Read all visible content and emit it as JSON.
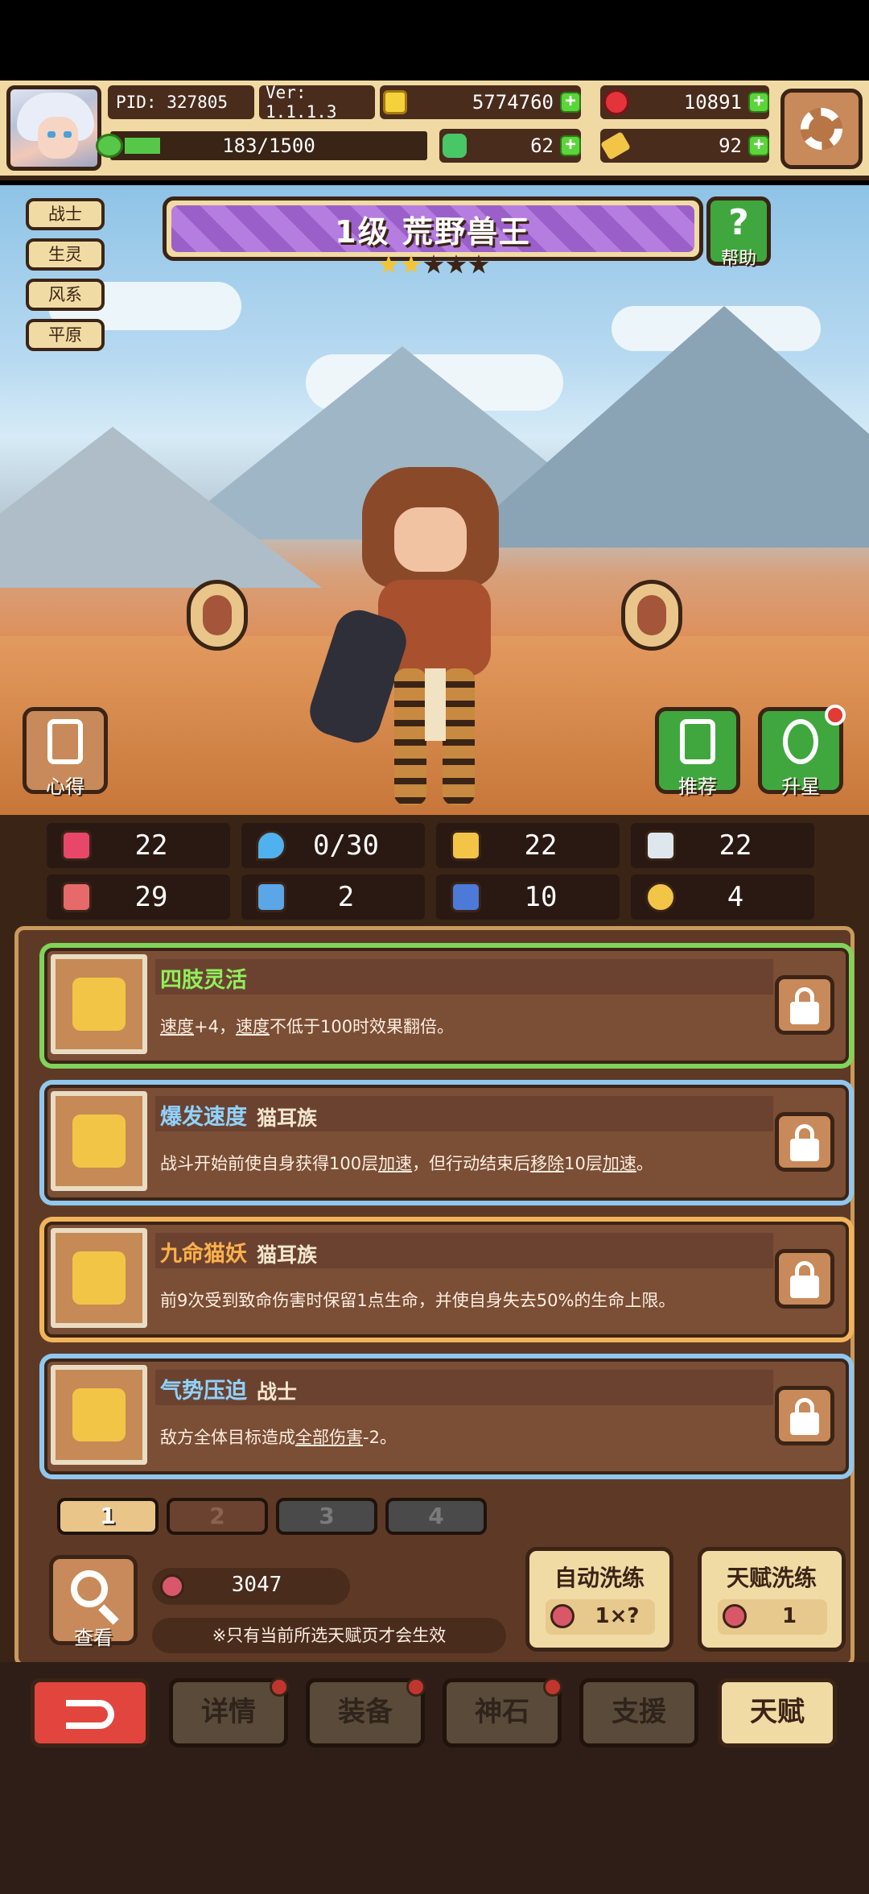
{
  "header": {
    "pid": "PID: 327805",
    "version": "Ver: 1.1.1.3",
    "gold": "5774760",
    "gems": "10891",
    "stamina": "183/1500",
    "stamina_fraction": 0.122,
    "clover": "62",
    "tickets": "92"
  },
  "hero": {
    "tags": [
      "战士",
      "生灵",
      "风系",
      "平原"
    ],
    "title": "1级 荒野兽王",
    "stars": 2,
    "stars_max": 5,
    "help_label": "帮助",
    "insight_label": "心得",
    "recommend_label": "推荐",
    "star_up_label": "升星"
  },
  "stats": [
    {
      "icon": "heart-icon",
      "value": "22"
    },
    {
      "icon": "water-drop-icon",
      "value": "0/30"
    },
    {
      "icon": "shield-icon",
      "value": "22"
    },
    {
      "icon": "wing-icon",
      "value": "22"
    },
    {
      "icon": "fist-icon",
      "value": "29"
    },
    {
      "icon": "book-icon",
      "value": "2"
    },
    {
      "icon": "boot-icon",
      "value": "10"
    },
    {
      "icon": "horn-icon",
      "value": "4"
    }
  ],
  "talents": [
    {
      "name": "四肢灵活",
      "class": "",
      "name_color": "#8ff05c",
      "border": "#7fd45a",
      "desc_parts": [
        [
          "速度",
          true
        ],
        [
          "+4，",
          false
        ],
        [
          "速度",
          true
        ],
        [
          "不低于100时效果翻倍。",
          false
        ]
      ]
    },
    {
      "name": "爆发速度",
      "class": "猫耳族",
      "name_color": "#8fd3ff",
      "border": "#8fc7ef",
      "desc_parts": [
        [
          "战斗开始前使自身获得100层",
          false
        ],
        [
          "加速",
          true
        ],
        [
          "，但行动结束后",
          false
        ],
        [
          "移除",
          true
        ],
        [
          "10层",
          false
        ],
        [
          "加速",
          true
        ],
        [
          "。",
          false
        ]
      ]
    },
    {
      "name": "九命猫妖",
      "class": "猫耳族",
      "name_color": "#ffb04a",
      "border": "#f2b45a",
      "desc_parts": [
        [
          "前9次受到致命伤害时保留1点生命，并使自身失去50%的生命上限。",
          false
        ]
      ]
    },
    {
      "name": "气势压迫",
      "class": "战士",
      "name_color": "#8fd3ff",
      "border": "#8fc7ef",
      "desc_parts": [
        [
          "敌方全体目标造成",
          false
        ],
        [
          "全部伤害",
          true
        ],
        [
          "-2。",
          false
        ]
      ]
    }
  ],
  "pages": [
    "1",
    "2",
    "3",
    "4"
  ],
  "bottom": {
    "view_label": "查看",
    "fruit_count": "3047",
    "note": "※只有当前所选天赋页才会生效",
    "auto_wash": {
      "title": "自动洗练",
      "cost": "1×?"
    },
    "talent_wash": {
      "title": "天赋洗练",
      "cost": "1"
    }
  },
  "nav": {
    "back": "back-arrow-icon",
    "items": [
      "详情",
      "装备",
      "神石",
      "支援",
      "天赋"
    ]
  }
}
